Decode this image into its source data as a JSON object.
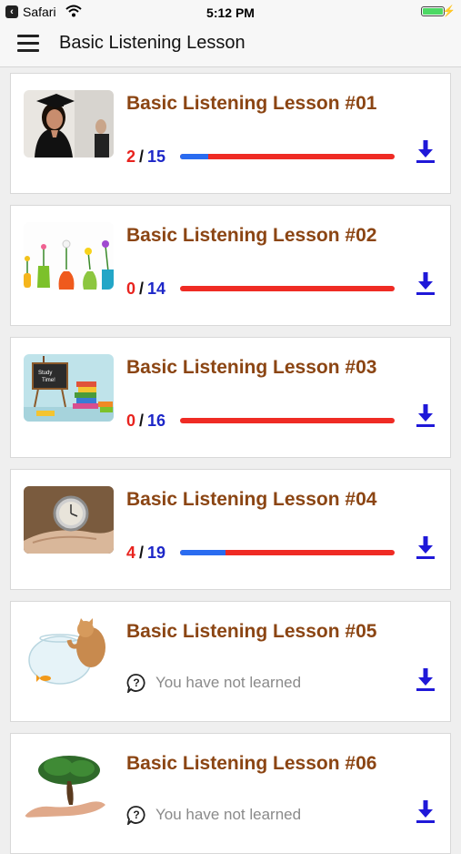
{
  "status_bar": {
    "carrier": "Safari",
    "time": "5:12 PM",
    "battery_color": "#4cd964"
  },
  "app_bar": {
    "title": "Basic Listening Lesson"
  },
  "colors": {
    "title": "#8b4513",
    "learned": "#e8231e",
    "total": "#1d27c8",
    "progress": "#2a6cf0",
    "track": "#ef2b24",
    "download": "#1f18d8"
  },
  "lessons": [
    {
      "title": "Basic Listening Lesson #01",
      "thumb": "graduate",
      "learned": "2",
      "sep": "/",
      "total": "15",
      "progress": 0.13
    },
    {
      "title": "Basic Listening Lesson #02",
      "thumb": "vases",
      "learned": "0",
      "sep": "/",
      "total": "14",
      "progress": 0
    },
    {
      "title": "Basic Listening Lesson #03",
      "thumb": "study-time",
      "learned": "0",
      "sep": "/",
      "total": "16",
      "progress": 0
    },
    {
      "title": "Basic Listening Lesson #04",
      "thumb": "clock-hand",
      "learned": "4",
      "sep": "/",
      "total": "19",
      "progress": 0.21
    },
    {
      "title": "Basic Listening Lesson #05",
      "thumb": "cat-fishbowl",
      "not_learned": "You have not learned"
    },
    {
      "title": "Basic Listening Lesson #06",
      "thumb": "tree-hand",
      "not_learned": "You have not learned"
    }
  ]
}
